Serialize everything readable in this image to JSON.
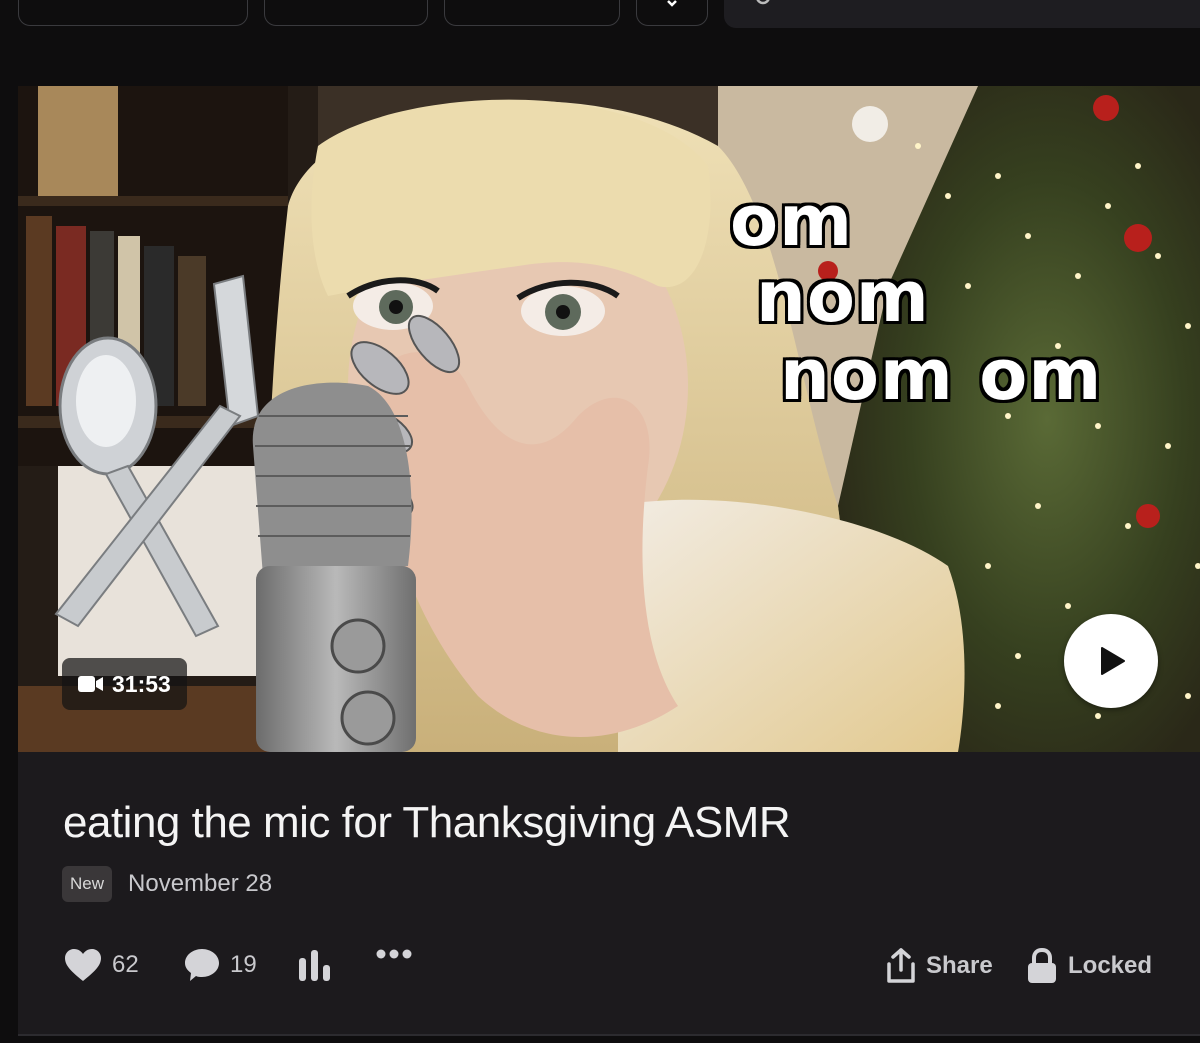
{
  "thumbnail": {
    "overlay_lines": [
      "om",
      "nom",
      "nom om"
    ],
    "duration": "31:53"
  },
  "post": {
    "title": "eating the mic for Thanksgiving ASMR",
    "badge": "New",
    "date": "November 28"
  },
  "actions": {
    "likes": "62",
    "comments": "19",
    "share_label": "Share",
    "locked_label": "Locked"
  },
  "colors": {
    "background": "#0e0d0e",
    "card": "#1c1a1d",
    "text": "#f4f4f4",
    "muted": "#c9c9cd"
  },
  "icons": [
    "heart-icon",
    "comment-icon",
    "stats-icon",
    "more-icon",
    "share-icon",
    "lock-icon",
    "video-camera-icon",
    "play-icon",
    "search-icon"
  ]
}
